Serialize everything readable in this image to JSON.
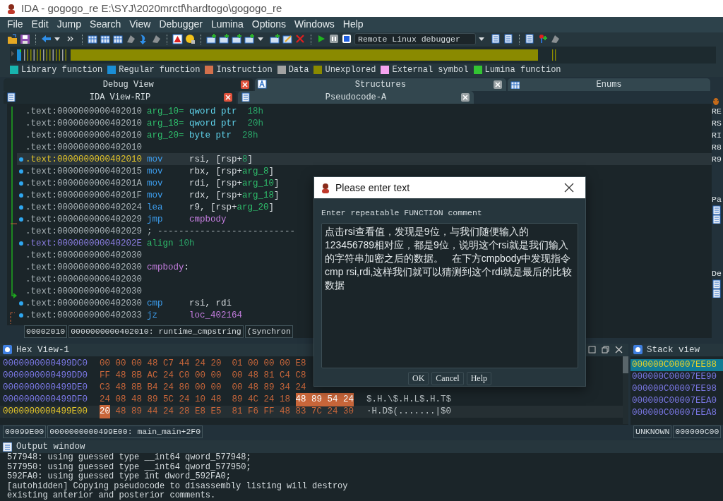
{
  "window": {
    "title": "IDA - gogogo_re E:\\SYJ\\2020mrctf\\hardtogo\\gogogo_re"
  },
  "menu": [
    "File",
    "Edit",
    "Jump",
    "Search",
    "View",
    "Debugger",
    "Lumina",
    "Options",
    "Windows",
    "Help"
  ],
  "toolbar": {
    "debugger": "Remote Linux debugger"
  },
  "legend": [
    {
      "label": "Library function",
      "color": "#18b4ae"
    },
    {
      "label": "Regular function",
      "color": "#1a8ed6"
    },
    {
      "label": "Instruction",
      "color": "#d2704c"
    },
    {
      "label": "Data",
      "color": "#a2a2a2"
    },
    {
      "label": "Unexplored",
      "color": "#8a8a00"
    },
    {
      "label": "External symbol",
      "color": "#f5a3f0"
    },
    {
      "label": "Lumina function",
      "color": "#33c433"
    }
  ],
  "tab_rows": [
    [
      {
        "label": "Debug View",
        "selected": true
      },
      {
        "label": "Structures",
        "selected": false
      },
      {
        "label": "Enums",
        "selected": false
      }
    ],
    [
      {
        "label": "IDA View-RIP",
        "selected": true
      },
      {
        "label": "Pseudocode-A",
        "selected": false
      }
    ]
  ],
  "listing": {
    "lines": [
      {
        "address": ".text:0000000000402010",
        "kind": "normal",
        "dot": false,
        "tokens": [
          {
            "text": "arg_10=",
            "kind": "var"
          },
          {
            "text": " qword ptr  ",
            "kind": "kw"
          },
          {
            "text": "18h",
            "kind": "num"
          }
        ]
      },
      {
        "address": ".text:0000000000402010",
        "kind": "normal",
        "dot": false,
        "tokens": [
          {
            "text": "arg_18=",
            "kind": "var"
          },
          {
            "text": " qword ptr  ",
            "kind": "kw"
          },
          {
            "text": "20h",
            "kind": "num"
          }
        ]
      },
      {
        "address": ".text:0000000000402010",
        "kind": "normal",
        "dot": false,
        "tokens": [
          {
            "text": "arg_20=",
            "kind": "var"
          },
          {
            "text": " byte ptr  ",
            "kind": "kw"
          },
          {
            "text": "28h",
            "kind": "num"
          }
        ]
      },
      {
        "address": ".text:0000000000402010",
        "kind": "normal",
        "dot": false
      },
      {
        "address": ".text:0000000000402010",
        "kind": "current",
        "dot": true,
        "tokens": [
          {
            "text": "mov",
            "kind": "mnem"
          },
          {
            "text": "rsi, [rsp+",
            "kind": "reg"
          },
          {
            "text": "8",
            "kind": "num"
          },
          {
            "text": "]",
            "kind": "reg"
          }
        ]
      },
      {
        "address": ".text:0000000000402015",
        "kind": "normal",
        "dot": true,
        "tokens": [
          {
            "text": "mov",
            "kind": "mnem"
          },
          {
            "text": "rbx, [rsp+",
            "kind": "reg"
          },
          {
            "text": "arg_8",
            "kind": "var"
          },
          {
            "text": "]",
            "kind": "reg"
          }
        ]
      },
      {
        "address": ".text:000000000040201A",
        "kind": "normal",
        "dot": true,
        "tokens": [
          {
            "text": "mov",
            "kind": "mnem"
          },
          {
            "text": "rdi, [rsp+",
            "kind": "reg"
          },
          {
            "text": "arg_10",
            "kind": "var"
          },
          {
            "text": "]",
            "kind": "reg"
          }
        ]
      },
      {
        "address": ".text:000000000040201F",
        "kind": "normal",
        "dot": true,
        "tokens": [
          {
            "text": "mov",
            "kind": "mnem"
          },
          {
            "text": "rdx, [rsp+",
            "kind": "reg"
          },
          {
            "text": "arg_18",
            "kind": "var"
          },
          {
            "text": "]",
            "kind": "reg"
          }
        ]
      },
      {
        "address": ".text:0000000000402024",
        "kind": "normal",
        "dot": true,
        "tokens": [
          {
            "text": "lea",
            "kind": "mnem"
          },
          {
            "text": "r9, [rsp+",
            "kind": "reg"
          },
          {
            "text": "arg_20",
            "kind": "var"
          },
          {
            "text": "]",
            "kind": "reg"
          }
        ]
      },
      {
        "address": ".text:0000000000402029",
        "kind": "normal",
        "dot": true,
        "tokens": [
          {
            "text": "jmp",
            "kind": "mnem"
          },
          {
            "text": "cmpbody",
            "kind": "name"
          }
        ]
      },
      {
        "address": ".text:0000000000402029",
        "kind": "normal",
        "dot": false,
        "tokens": [
          {
            "text": "; --------------------------",
            "kind": "comment"
          }
        ]
      },
      {
        "address": ".text:000000000040202E",
        "kind": "alt",
        "dot": true,
        "tokens": [
          {
            "text": "align ",
            "kind": "var"
          },
          {
            "text": "10h",
            "kind": "num"
          }
        ]
      },
      {
        "address": ".text:0000000000402030",
        "kind": "normal",
        "dot": false
      },
      {
        "address": ".text:0000000000402030",
        "kind": "normal",
        "dot": false,
        "tokens": [
          {
            "text": "cmpbody",
            "kind": "name"
          },
          {
            "text": ":",
            "kind": "reg"
          }
        ]
      },
      {
        "address": ".text:0000000000402030",
        "kind": "normal",
        "dot": false
      },
      {
        "address": ".text:0000000000402030",
        "kind": "normal",
        "dot": false
      },
      {
        "address": ".text:0000000000402030",
        "kind": "normal",
        "dot": true,
        "tokens": [
          {
            "text": "cmp",
            "kind": "mnem"
          },
          {
            "text": "rsi, rdi",
            "kind": "reg"
          }
        ]
      },
      {
        "address": ".text:0000000000402033",
        "kind": "normal",
        "dot": true,
        "tokens": [
          {
            "text": "jz",
            "kind": "mnem"
          },
          {
            "text": "loc_402164",
            "kind": "name"
          }
        ]
      }
    ],
    "status": [
      "00002010",
      "0000000000402010: runtime_cmpstring",
      "(Synchron"
    ]
  },
  "right_panel": {
    "registers": [
      "RE",
      "RS",
      "RI",
      "R8",
      "R9"
    ],
    "panes": [
      "Pa",
      "De"
    ]
  },
  "hex_view": {
    "title": "Hex View-1",
    "rows": [
      {
        "address": "0000000000499DC0",
        "current": false,
        "segments": [
          {
            "text": "00 00 00 48 C7 44 24 20  01 00 00 00 E8",
            "selected": false
          }
        ]
      },
      {
        "address": "0000000000499DD0",
        "current": false,
        "segments": [
          {
            "text": "FF 48 8B AC 24 C0 00 00  00 48 81 C4 C8",
            "selected": false
          }
        ]
      },
      {
        "address": "0000000000499DE0",
        "current": false,
        "segments": [
          {
            "text": "C3 48 8B B4 24 80 00 00  00 48 89 34 24",
            "selected": false
          }
        ]
      },
      {
        "address": "0000000000499DF0",
        "current": false,
        "segments": [
          {
            "text": "24 08 48 89 5C 24 10 48  89 4C 24 18",
            "selected": false
          },
          {
            "text": "48 89 54 24",
            "selected": true
          }
        ],
        "ascii": "$.H.\\$.H.L$.H.T$"
      },
      {
        "address": "0000000000499E00",
        "current": true,
        "segments": [
          {
            "text": "20",
            "selected": true
          },
          {
            "text": "48 89 44 24 28 E8 E5  81 F6 FF 48 83 7C 24 30",
            "selected": false
          }
        ],
        "ascii": "·H.D$(.......|$0"
      }
    ],
    "status": [
      "00099E00",
      "0000000000499E00: main_main+2F0"
    ]
  },
  "stack_view": {
    "title": "Stack view",
    "rows": [
      {
        "address": "000000C00007EE88",
        "selected": true
      },
      {
        "address": "000000C00007EE90",
        "selected": false
      },
      {
        "address": "000000C00007EE98",
        "selected": false
      },
      {
        "address": "000000C00007EEA0",
        "selected": false
      },
      {
        "address": "000000C00007EEA8",
        "selected": false
      }
    ],
    "status": [
      "UNKNOWN",
      "000000C00"
    ]
  },
  "output": {
    "title": "Output window",
    "lines": [
      "577948: using guessed type __int64 qword_577948;",
      "577950: using guessed type __int64 qword_577950;",
      "592FA0: using guessed type int dword_592FA0;",
      "[autohidden] Copying pseudocode to disassembly listing will destroy",
      "existing anterior and posterior comments."
    ]
  },
  "dialog": {
    "title": "Please enter text",
    "label": "Enter repeatable FUNCTION comment",
    "value": "点击rsi查看值，发现是9位，与我们随便输入的123456789相对应，都是9位，说明这个rsi就是我们输入的字符串加密之后的数据。   在下方cmpbody中发现指令cmp rsi,rdi,这样我们就可以猜测到这个rdi就是最后的比较数据",
    "buttons": [
      "OK",
      "Cancel",
      "Help"
    ]
  }
}
